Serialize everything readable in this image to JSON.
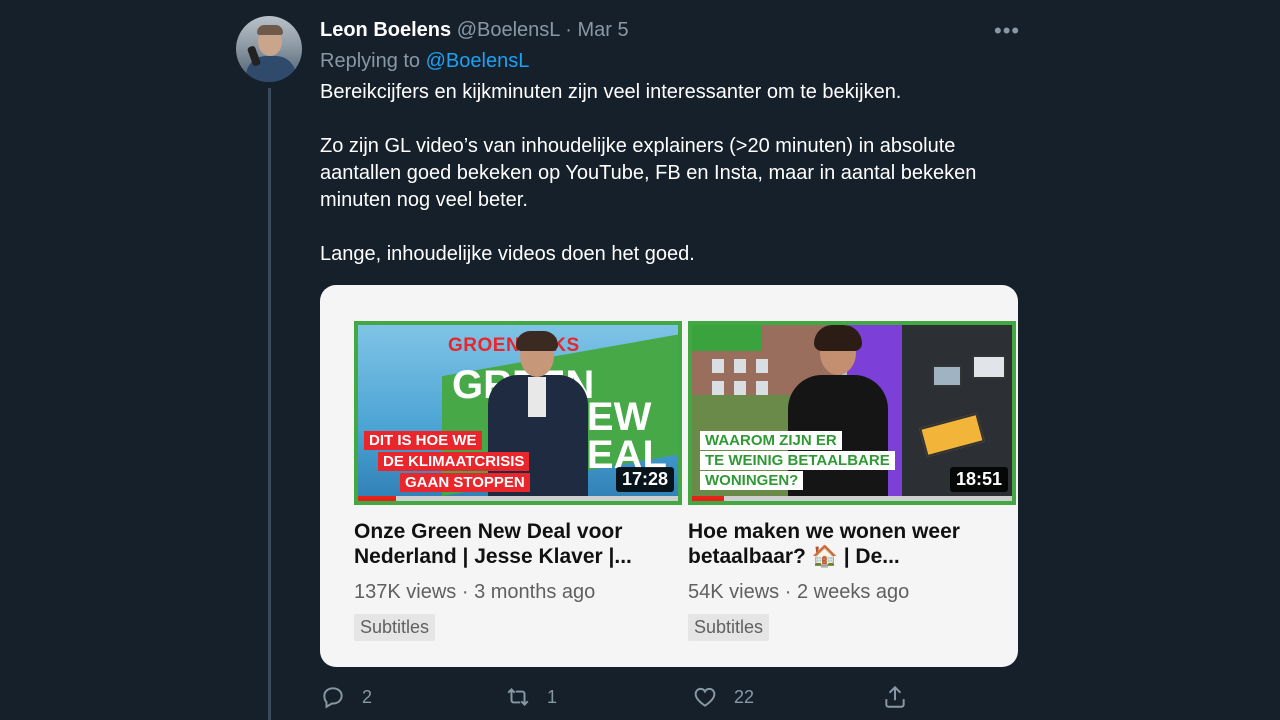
{
  "tweet": {
    "author_name": "Leon Boelens",
    "author_handle": "@BoelensL",
    "separator": "·",
    "date": "Mar 5",
    "replying_prefix": "Replying to",
    "replying_handle": "@BoelensL",
    "paragraphs": [
      "Bereikcijfers en kijkminuten zijn veel interessanter om te bekijken.",
      "Zo zijn GL video’s van inhoudelijke explainers (>20 minuten) in absolute aantallen goed bekeken op YouTube, FB en Insta, maar in aantal bekeken minuten nog veel beter.",
      "Lange, inhoudelijke videos doen het goed."
    ]
  },
  "videos": [
    {
      "title": "Onze Green New Deal voor Nederland | Jesse Klaver |...",
      "views": "137K views",
      "age": "3 months ago",
      "badge": "Subtitles",
      "duration": "17:28",
      "thumb_brand": "GROENLINKS",
      "thumb_big": [
        "GREEN",
        "NEW",
        "DEAL"
      ],
      "thumb_caption": [
        "DIT IS HOE WE",
        "DE KLIMAATCRISIS",
        "GAAN STOPPEN"
      ],
      "watched_fraction": 0.12
    },
    {
      "title": "Hoe maken we wonen weer betaalbaar? 🏠 | De...",
      "views": "54K views",
      "age": "2 weeks ago",
      "badge": "Subtitles",
      "duration": "18:51",
      "thumb_caption": [
        "WAAROM ZIJN ER",
        "TE WEINIG BETAALBARE",
        "WONINGEN?"
      ],
      "watched_fraction": 0.1
    }
  ],
  "meta_separator": "·",
  "actions": {
    "reply_count": "2",
    "retweet_count": "1",
    "like_count": "22"
  },
  "colors": {
    "background": "#16202b",
    "link": "#1da1f2",
    "muted": "#8899a6",
    "thumb_border": "#43a843",
    "progress": "#e62117"
  }
}
